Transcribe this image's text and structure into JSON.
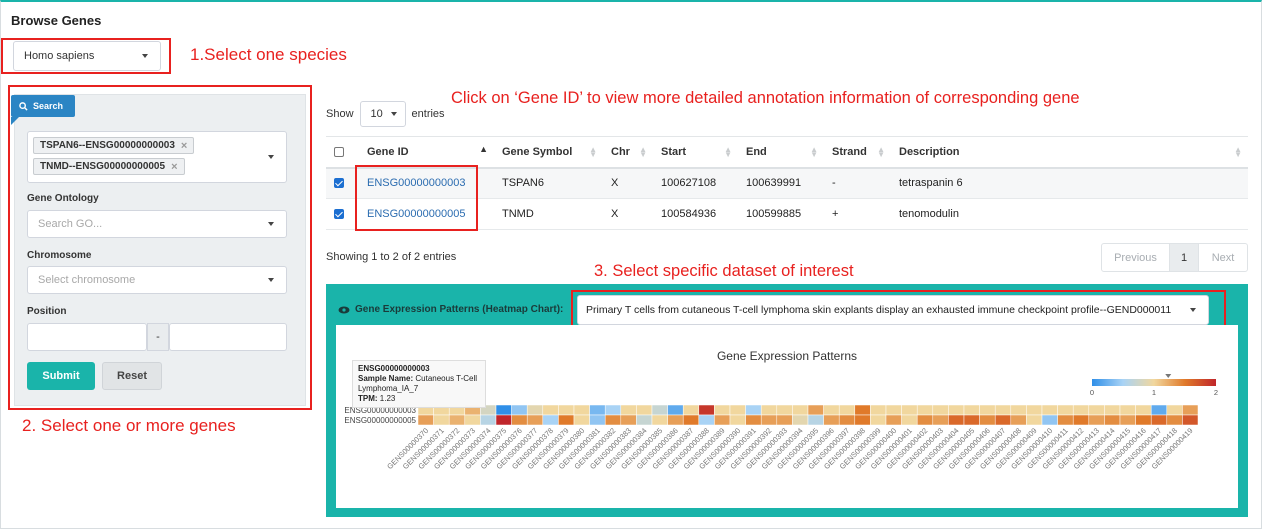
{
  "page": {
    "title": "Browse Genes"
  },
  "species_select": {
    "value": "Homo sapiens"
  },
  "annotations": {
    "a1": "1.Select one species",
    "a2": "2. Select one or more genes",
    "a3": "3. Select specific dataset of interest",
    "a_gene_id": "Click on ‘Gene ID’ to view more detailed annotation information of corresponding gene"
  },
  "sidebar": {
    "search_tab": "Search",
    "search_icon": "search-icon",
    "selected_genes": [
      "TSPAN6--ENSG00000000003",
      "TNMD--ENSG00000000005"
    ],
    "tag_remove": "×",
    "go_label": "Gene Ontology",
    "go_placeholder": "Search GO...",
    "chr_label": "Chromosome",
    "chr_placeholder": "Select chromosome",
    "pos_label": "Position",
    "pos_sep": "-",
    "submit": "Submit",
    "reset": "Reset"
  },
  "table_controls": {
    "show": "Show",
    "page_length": "10",
    "entries": "entries"
  },
  "table": {
    "columns": [
      "Gene ID",
      "Gene Symbol",
      "Chr",
      "Start",
      "End",
      "Strand",
      "Description"
    ],
    "rows": [
      {
        "checked": true,
        "gene_id": "ENSG00000000003",
        "symbol": "TSPAN6",
        "chr": "X",
        "start": "100627108",
        "end": "100639991",
        "strand": "-",
        "description": "tetraspanin 6"
      },
      {
        "checked": true,
        "gene_id": "ENSG00000000005",
        "symbol": "TNMD",
        "chr": "X",
        "start": "100584936",
        "end": "100599885",
        "strand": "+",
        "description": "tenomodulin"
      }
    ]
  },
  "table_info": "Showing 1 to 2 of 2 entries",
  "pagination": {
    "previous": "Previous",
    "current": "1",
    "next": "Next"
  },
  "heatmap_panel": {
    "label": "Gene Expression Patterns (Heatmap Chart):",
    "eye_icon": "eye-icon",
    "dataset": "Primary T cells from cutaneous T-cell lymphoma skin explants display an exhausted immune checkpoint profile--GEND000011"
  },
  "tooltip": {
    "gene": "ENSG00000000003",
    "sample_label": "Sample Name:",
    "sample_value": "Cutaneous T-Cell Lymphoma_IA_7",
    "tpm_label": "TPM:",
    "tpm_value": "1.23"
  },
  "chart_data": {
    "type": "heatmap",
    "title": "Gene Expression Patterns",
    "rows": [
      "ENSG00000000003",
      "ENSG00000000005"
    ],
    "columns": [
      "GENS00000370",
      "GENS00000371",
      "GENS00000372",
      "GENS00000373",
      "GENS00000374",
      "GENS00000375",
      "GENS00000376",
      "GENS00000377",
      "GENS00000378",
      "GENS00000379",
      "GENS00000380",
      "GENS00000381",
      "GENS00000382",
      "GENS00000383",
      "GENS00000384",
      "GENS00000385",
      "GENS00000386",
      "GENS00000387",
      "GENS00000388",
      "GENS00000389",
      "GENS00000390",
      "GENS00000391",
      "GENS00000392",
      "GENS00000393",
      "GENS00000394",
      "GENS00000395",
      "GENS00000396",
      "GENS00000397",
      "GENS00000398",
      "GENS00000399",
      "GENS00000400",
      "GENS00000401",
      "GENS00000402",
      "GENS00000403",
      "GENS00000404",
      "GENS00000405",
      "GENS00000406",
      "GENS00000407",
      "GENS00000408",
      "GENS00000409",
      "GENS00000410",
      "GENS00000411",
      "GENS00000412",
      "GENS00000413",
      "GENS00000414",
      "GENS00000415",
      "GENS00000416",
      "GENS00000417",
      "GENS00000418",
      "GENS00000419"
    ],
    "values": [
      [
        1.0,
        1.0,
        1.0,
        1.2,
        0.8,
        0.0,
        0.4,
        0.9,
        1.0,
        1.0,
        1.0,
        0.3,
        0.5,
        1.0,
        1.0,
        0.7,
        0.2,
        1.0,
        1.9,
        1.0,
        1.0,
        0.5,
        1.0,
        1.0,
        1.0,
        1.3,
        1.0,
        1.0,
        1.5,
        1.0,
        1.0,
        1.0,
        1.0,
        1.0,
        1.0,
        1.0,
        1.0,
        1.0,
        1.0,
        1.0,
        1.0,
        1.0,
        1.0,
        1.0,
        1.0,
        1.0,
        1.0,
        0.2,
        1.0,
        1.3
      ],
      [
        1.3,
        1.0,
        1.2,
        1.0,
        0.6,
        2.0,
        1.4,
        1.3,
        0.5,
        1.5,
        1.0,
        0.4,
        1.4,
        1.3,
        0.7,
        1.0,
        1.3,
        1.5,
        0.5,
        1.3,
        1.0,
        1.4,
        1.3,
        1.3,
        0.9,
        0.6,
        1.3,
        1.4,
        1.5,
        1.0,
        1.3,
        1.0,
        1.4,
        1.3,
        1.6,
        1.6,
        1.4,
        1.6,
        1.3,
        1.0,
        0.4,
        1.4,
        1.5,
        1.3,
        1.4,
        1.3,
        1.5,
        1.6,
        1.4,
        1.7
      ]
    ],
    "color_scale": {
      "min": 0,
      "max": 2,
      "ticks": [
        "0",
        "1",
        "2"
      ],
      "colors": [
        "#2f8fe8",
        "#a9d3f5",
        "#f1d79e",
        "#e07a2a",
        "#c0262b"
      ]
    },
    "highlight_value": 1.23
  }
}
